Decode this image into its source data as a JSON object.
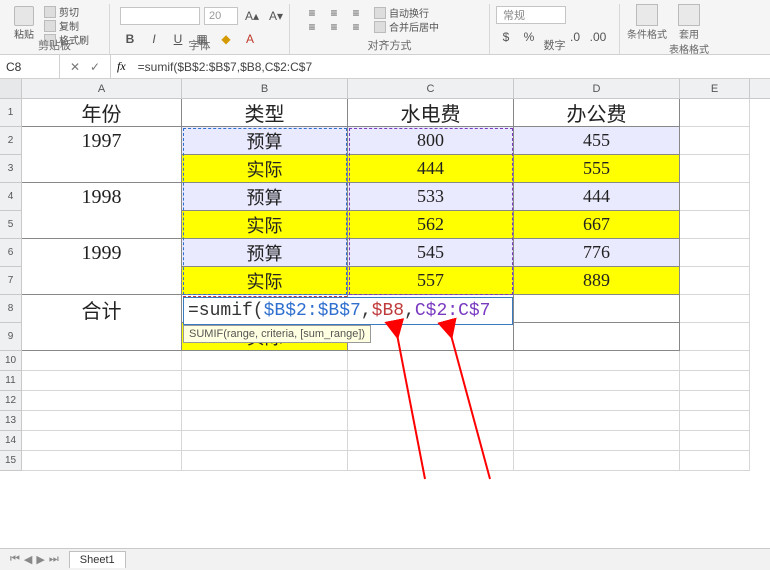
{
  "ribbon": {
    "clipboard": {
      "label": "剪贴板",
      "paste": "粘贴",
      "cut": "剪切",
      "copy": "复制",
      "format_painter": "格式刷"
    },
    "font": {
      "label": "字体",
      "name_placeholder": "",
      "size_placeholder": "20"
    },
    "align": {
      "label": "对齐方式",
      "wrap": "自动换行",
      "merge": "合并后居中"
    },
    "number": {
      "label": "数字",
      "format": "常规"
    },
    "styles": {
      "cond_format": "条件格式",
      "table_format": "套用\n表格格式"
    }
  },
  "formula_bar": {
    "name_box": "C8",
    "formula": "=sumif($B$2:$B$7,$B8,C$2:C$7"
  },
  "columns": [
    "A",
    "B",
    "C",
    "D",
    "E"
  ],
  "headers": {
    "year": "年份",
    "type": "类型",
    "util": "水电费",
    "office": "办公费"
  },
  "type_labels": {
    "budget": "预算",
    "actual": "实际"
  },
  "rows": [
    {
      "year": "1997",
      "type": "预算",
      "util": "800",
      "office": "455",
      "hl": "lav"
    },
    {
      "year": "",
      "type": "实际",
      "util": "444",
      "office": "555",
      "hl": "yellow"
    },
    {
      "year": "1998",
      "type": "预算",
      "util": "533",
      "office": "444",
      "hl": "lav"
    },
    {
      "year": "",
      "type": "实际",
      "util": "562",
      "office": "667",
      "hl": "yellow"
    },
    {
      "year": "1999",
      "type": "预算",
      "util": "545",
      "office": "776",
      "hl": "lav"
    },
    {
      "year": "",
      "type": "实际",
      "util": "557",
      "office": "889",
      "hl": "yellow"
    }
  ],
  "total_label": "合计",
  "editing": {
    "fn": "=sumif(",
    "arg1": "$B$2:$B$7",
    "comma": ", ",
    "arg2": "$B8",
    "comma2": ", ",
    "arg3": "C$2:C$7",
    "hint": "SUMIF(range, criteria, [sum_range])"
  },
  "row9_actual": "实际",
  "sheet": {
    "name": "Sheet1"
  }
}
